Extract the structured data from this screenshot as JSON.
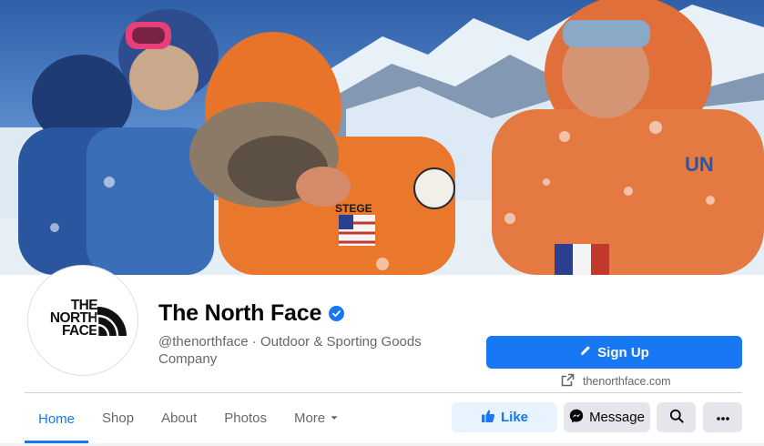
{
  "page": {
    "name": "The North Face",
    "handle_category": "@thenorthface · Outdoor & Sporting Goods Company",
    "website": "thenorthface.com"
  },
  "logo": {
    "line1": "THE",
    "line2": "NORTH",
    "line3": "FACE"
  },
  "cover": {
    "patch_text": "STEGE",
    "sleeve_text": "UN"
  },
  "actions": {
    "signup_label": "Sign Up",
    "like_label": "Like",
    "message_label": "Message"
  },
  "tabs": [
    {
      "label": "Home",
      "active": true
    },
    {
      "label": "Shop"
    },
    {
      "label": "About"
    },
    {
      "label": "Photos"
    },
    {
      "label": "More"
    }
  ],
  "icons": {
    "verified": "verified-badge-icon",
    "signup": "pencil-icon",
    "website": "external-link-icon",
    "like": "thumbs-up-icon",
    "message": "messenger-icon",
    "search": "search-icon",
    "more": "ellipsis-icon",
    "more_tab": "caret-down-icon"
  },
  "colors": {
    "primary": "#1877f2",
    "primary_light": "#e7f3ff",
    "secondary_button": "#e4e6eb",
    "text_primary": "#050505",
    "text_secondary": "#65676b"
  }
}
